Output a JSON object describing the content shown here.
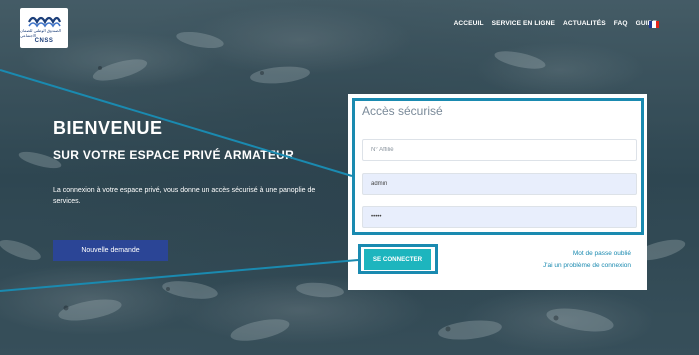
{
  "header": {
    "logo_ar": "الصندوق الوطني للضمان الاجتماعي",
    "logo_text": "CNSS",
    "nav": [
      "ACCEUIL",
      "SERVICE EN LIGNE",
      "ACTUALITÉS",
      "FAQ",
      "GUIDE"
    ],
    "flag_colors": [
      "#1f3a93",
      "#ffffff",
      "#e1261c"
    ]
  },
  "welcome": {
    "title": "BIENVENUE",
    "subtitle": "SUR VOTRE ESPACE PRIVÉ ARMATEUR",
    "description": "La connexion à votre espace privé, vous donne un accès sécurisé à une panoplie de services.",
    "new_request_label": "Nouvelle demande"
  },
  "login": {
    "title": "Accès sécurisé",
    "affilie_placeholder": "N° Affilié",
    "login_value": "admin",
    "password_value": "•••••",
    "connect_label": "SE CONNECTER",
    "forgot_label": "Mot de passe oublié",
    "problem_label": "J'ai un problème de connexion"
  },
  "colors": {
    "accent": "#1a8ab0",
    "connect_button": "#1db5be",
    "new_request_button": "#2b4596"
  }
}
